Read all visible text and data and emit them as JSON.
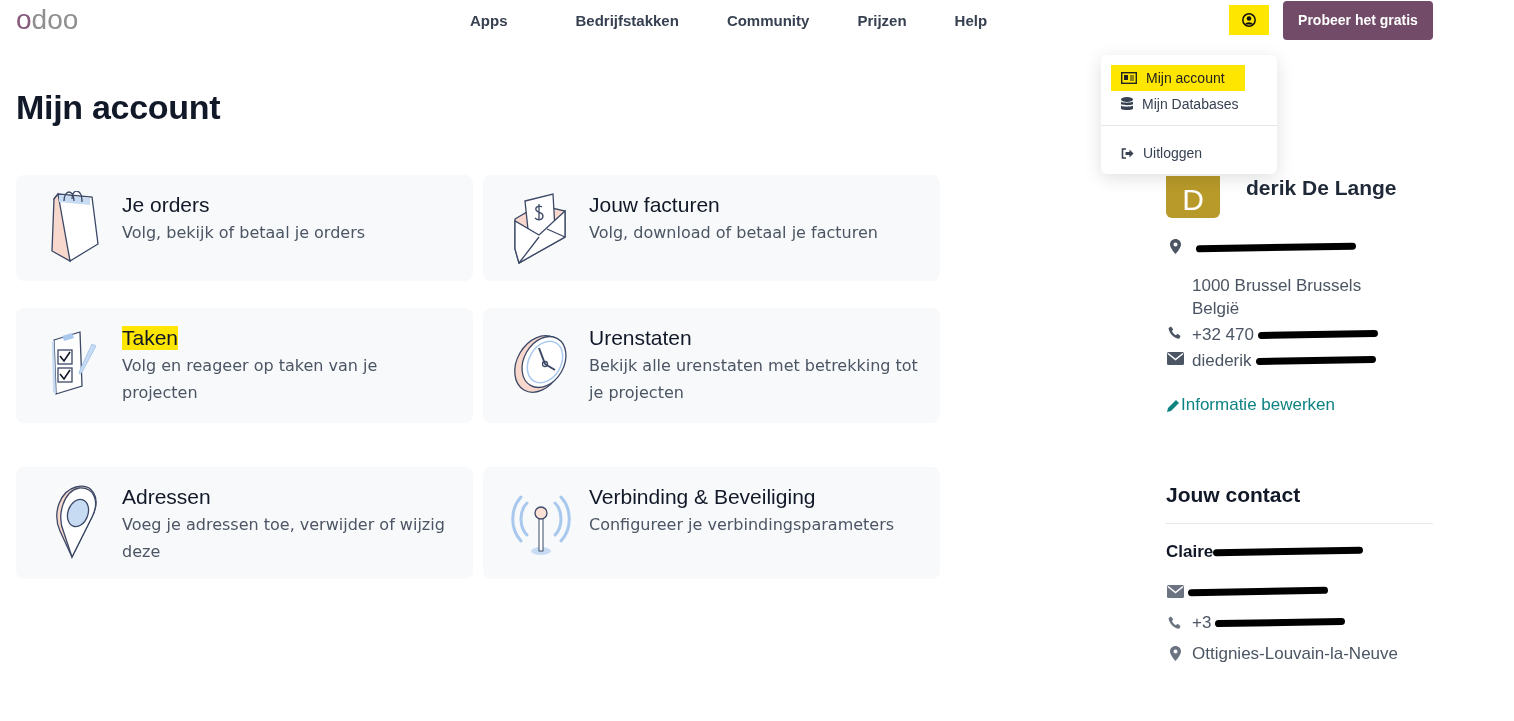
{
  "logo": "odoo",
  "nav": {
    "items": [
      "Apps",
      "Bedrijfstakken",
      "Community",
      "Prijzen",
      "Help"
    ],
    "user_highlighted": true,
    "cta": "Probeer het gratis"
  },
  "dropdown": {
    "items": [
      {
        "kind": "account",
        "label": "Mijn account",
        "highlighted": true
      },
      {
        "kind": "database",
        "label": "Mijn Databases",
        "highlighted": false
      },
      {
        "kind": "divider"
      },
      {
        "kind": "logout",
        "label": "Uitloggen",
        "highlighted": false
      }
    ]
  },
  "title": "Mijn account",
  "cards": [
    {
      "kind": "bag",
      "title": "Je orders",
      "text": "Volg, bekijk of betaal je orders",
      "highlighted": false
    },
    {
      "kind": "invoice",
      "title": "Jouw facturen",
      "text": "Volg, download of betaal je facturen",
      "highlighted": false
    },
    {
      "kind": "tasks",
      "title": "Taken",
      "text": "Volg en reageer op taken van je projecten",
      "highlighted": true
    },
    {
      "kind": "clock",
      "title": "Urenstaten",
      "text": "Bekijk alle urenstaten met betrekking tot je projecten",
      "highlighted": false
    },
    {
      "kind": "pin",
      "title": "Adressen",
      "text": "Voeg je adressen toe, verwijder of wijzig deze",
      "highlighted": false
    },
    {
      "kind": "antenna",
      "title": "Verbinding & Beveiliging",
      "text": "Configureer je verbindingsparameters",
      "highlighted": false
    }
  ],
  "profile": {
    "avatar": "D",
    "name": "derik De Lange",
    "details": [
      {
        "kind": "pin",
        "redacted": true
      },
      {
        "kind": "none",
        "lines": [
          "1000 Brussel Brussels",
          "België"
        ],
        "redacted": false
      },
      {
        "kind": "phone",
        "lines": [
          "+32 470"
        ],
        "redacted": true
      },
      {
        "kind": "mail",
        "lines": [
          "diederik"
        ],
        "redacted": true
      }
    ],
    "edit_link": "Informatie bewerken"
  },
  "contact": {
    "heading": "Jouw contact",
    "name": "Claire",
    "details": [
      {
        "kind": "mail",
        "redacted": true
      },
      {
        "kind": "phone",
        "text": "+3",
        "redacted": true
      },
      {
        "kind": "pin",
        "text": "Ottignies-Louvain-la-Neuve",
        "redacted": false
      }
    ]
  }
}
